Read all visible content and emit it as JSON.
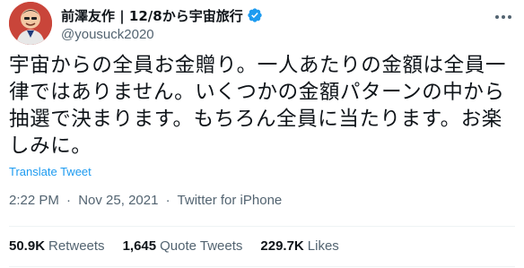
{
  "author": {
    "display_name": "前澤友作 | 12/8から宇宙旅行",
    "handle": "@yousuck2020",
    "verified": true
  },
  "tweet": {
    "text": "宇宙からの全員お金贈り。一人あたりの金額は全員一律ではありません。いくつかの金額パターンの中から抽選で決まります。もちろん全員に当たります。お楽しみに。",
    "translate_label": "Translate Tweet",
    "time": "2:22 PM",
    "date": "Nov 25, 2021",
    "source": "Twitter for iPhone",
    "separator": "·"
  },
  "stats": {
    "retweets_count": "50.9K",
    "retweets_label": "Retweets",
    "quotes_count": "1,645",
    "quotes_label": "Quote Tweets",
    "likes_count": "229.7K",
    "likes_label": "Likes"
  },
  "colors": {
    "accent": "#1d9bf0",
    "secondary_text": "#536471",
    "primary_text": "#0f1419"
  }
}
